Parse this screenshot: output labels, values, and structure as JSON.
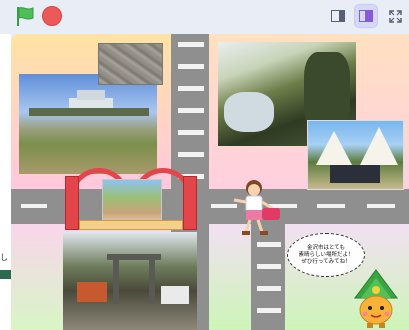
{
  "toolbar": {
    "green_flag_icon": "green-flag-icon",
    "stop_icon": "stop-icon",
    "small_stage_icon": "small-stage-icon",
    "large_stage_icon": "large-stage-icon",
    "fullscreen_icon": "fullscreen-icon",
    "colors": {
      "flag": "#4cbf56",
      "stop": "#ec5959",
      "active_view": "#d6d9f6"
    }
  },
  "left_edge": {
    "text": "し"
  },
  "stage": {
    "colors": {
      "road": "#8f8f8f",
      "stripe": "#f2f2f2",
      "bridge": "#e4454a"
    },
    "speech_bubble": {
      "line1": "金沢市はとても",
      "line2": "素晴らしい場所だよ！",
      "line3": "ぜひ行ってみてね！"
    }
  }
}
